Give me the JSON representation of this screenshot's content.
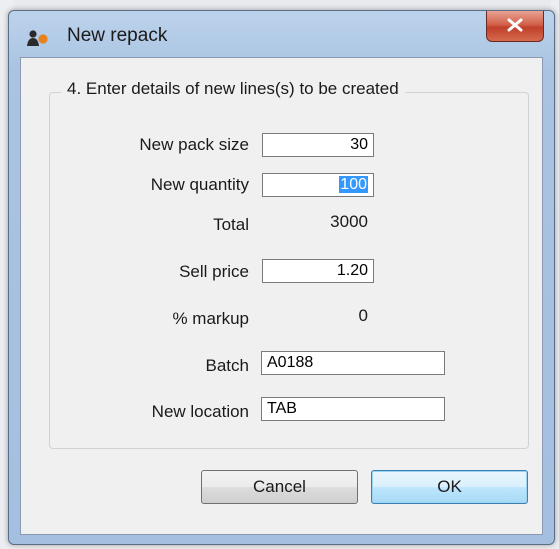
{
  "window": {
    "title": "New repack",
    "close_glyph": "x"
  },
  "group": {
    "title": "4. Enter details of new lines(s) to be created"
  },
  "form": {
    "pack_size": {
      "label": "New pack size",
      "value": "30"
    },
    "quantity": {
      "label": "New quantity",
      "value": "100"
    },
    "total": {
      "label": "Total",
      "value": "3000"
    },
    "sell_price": {
      "label": "Sell price",
      "value": "1.20"
    },
    "markup": {
      "label": "% markup",
      "value": "0"
    },
    "batch": {
      "label": "Batch",
      "value": "A0188"
    },
    "location": {
      "label": "New location",
      "value": "TAB"
    }
  },
  "buttons": {
    "cancel": "Cancel",
    "ok": "OK"
  },
  "colors": {
    "title_bar": "#a9c3e1",
    "close_button": "#c0402a",
    "selection": "#3399ff",
    "default_button": "#bee6fd"
  },
  "icons": {
    "app": "repack-app-icon",
    "close": "close-icon"
  }
}
